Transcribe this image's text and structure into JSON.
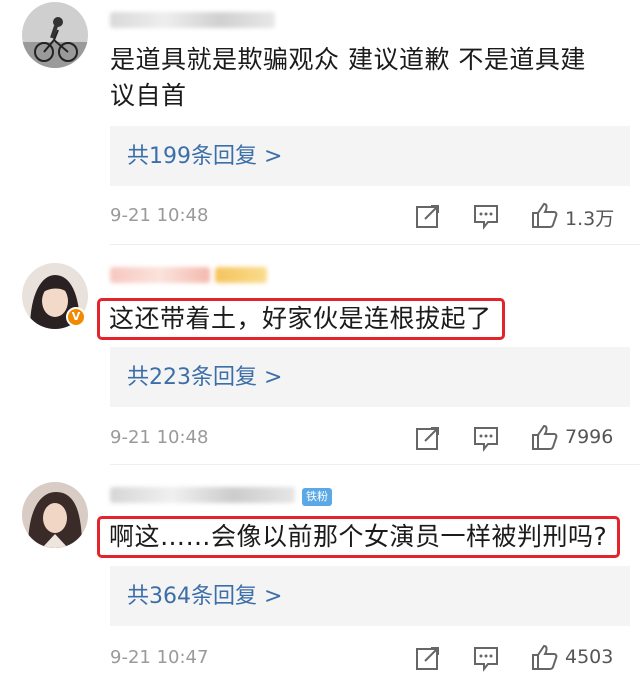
{
  "comments": [
    {
      "text": "是道具就是欺骗观众 建议道歉 不是道具建议自首",
      "text_line1": "是道具就是欺骗观众 建议道歉 不是道具建",
      "text_line2": "议自首",
      "replies": "共199条回复 >",
      "time": "9-21 10:48",
      "likes": "1.3万",
      "share_icon": "share-icon",
      "comment_icon": "comment-icon",
      "like_icon": "thumbs-up-icon"
    },
    {
      "text": "这还带着土，好家伙是连根拔起了",
      "badge": "V",
      "replies": "共223条回复 >",
      "time": "9-21 10:48",
      "likes": "7996"
    },
    {
      "text": "啊这……会像以前那个女演员一样被判刑吗?",
      "tag": "铁粉",
      "replies": "共364条回复 >",
      "time": "9-21 10:47",
      "likes": "4503"
    }
  ],
  "colors": {
    "link": "#3c6ea8",
    "highlight_border": "#e3242b",
    "vip_badge": "#f28a00",
    "fan_tag": "#5aa9e6"
  }
}
